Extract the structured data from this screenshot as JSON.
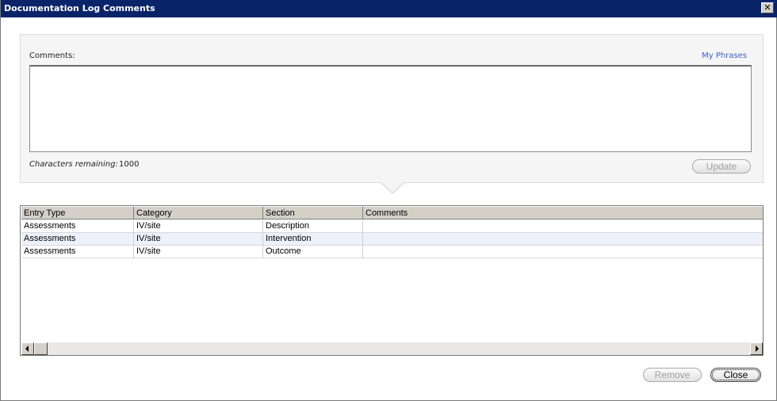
{
  "window": {
    "title": "Documentation Log Comments",
    "close_glyph": "✕"
  },
  "comment_panel": {
    "label": "Comments:",
    "phrases_link": "My Phrases",
    "text_value": "",
    "chars_remaining_label": "Characters remaining:",
    "chars_remaining_value": "1000",
    "update_label": "Update"
  },
  "grid": {
    "columns": [
      "Entry Type",
      "Category",
      "Section",
      "Comments"
    ],
    "rows": [
      {
        "entry_type": "Assessments",
        "category": "IV/site",
        "section": "Description",
        "comments": ""
      },
      {
        "entry_type": "Assessments",
        "category": "IV/site",
        "section": "Intervention",
        "comments": ""
      },
      {
        "entry_type": "Assessments",
        "category": "IV/site",
        "section": "Outcome",
        "comments": ""
      }
    ]
  },
  "footer": {
    "remove_label": "Remove",
    "close_label": "Close"
  },
  "colors": {
    "titlebar": "#0a246a",
    "link": "#3a5fcd",
    "selected_row": "#eef1fb",
    "disabled_text": "#a0a0a0"
  },
  "icons": {
    "window_close": "close-icon",
    "scroll_left": "arrow-left-icon",
    "scroll_right": "arrow-right-icon"
  }
}
